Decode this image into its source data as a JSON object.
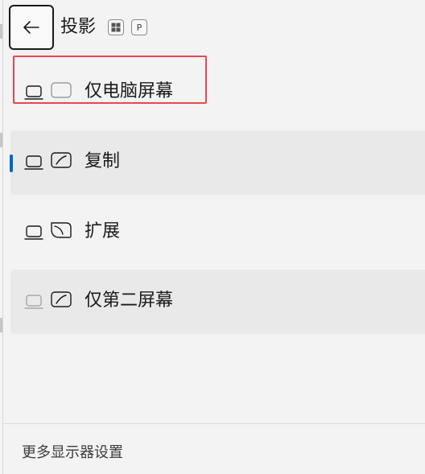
{
  "header": {
    "title": "投影",
    "shortcut_keys": [
      "⊞",
      "P"
    ]
  },
  "options": [
    {
      "label": "仅电脑屏幕",
      "icon": "pc-screen-only-icon",
      "shaded": false,
      "highlighted": true,
      "selected": false
    },
    {
      "label": "复制",
      "icon": "duplicate-icon",
      "shaded": true,
      "highlighted": false,
      "selected": true
    },
    {
      "label": "扩展",
      "icon": "extend-icon",
      "shaded": false,
      "highlighted": false,
      "selected": false
    },
    {
      "label": "仅第二屏幕",
      "icon": "second-screen-only-icon",
      "shaded": true,
      "highlighted": false,
      "selected": false
    }
  ],
  "footer": {
    "link_label": "更多显示器设置"
  },
  "colors": {
    "accent": "#0067c0",
    "highlight_border": "#e5484d",
    "row_shade": "#e9e9e9",
    "background": "#f3f3f3"
  }
}
